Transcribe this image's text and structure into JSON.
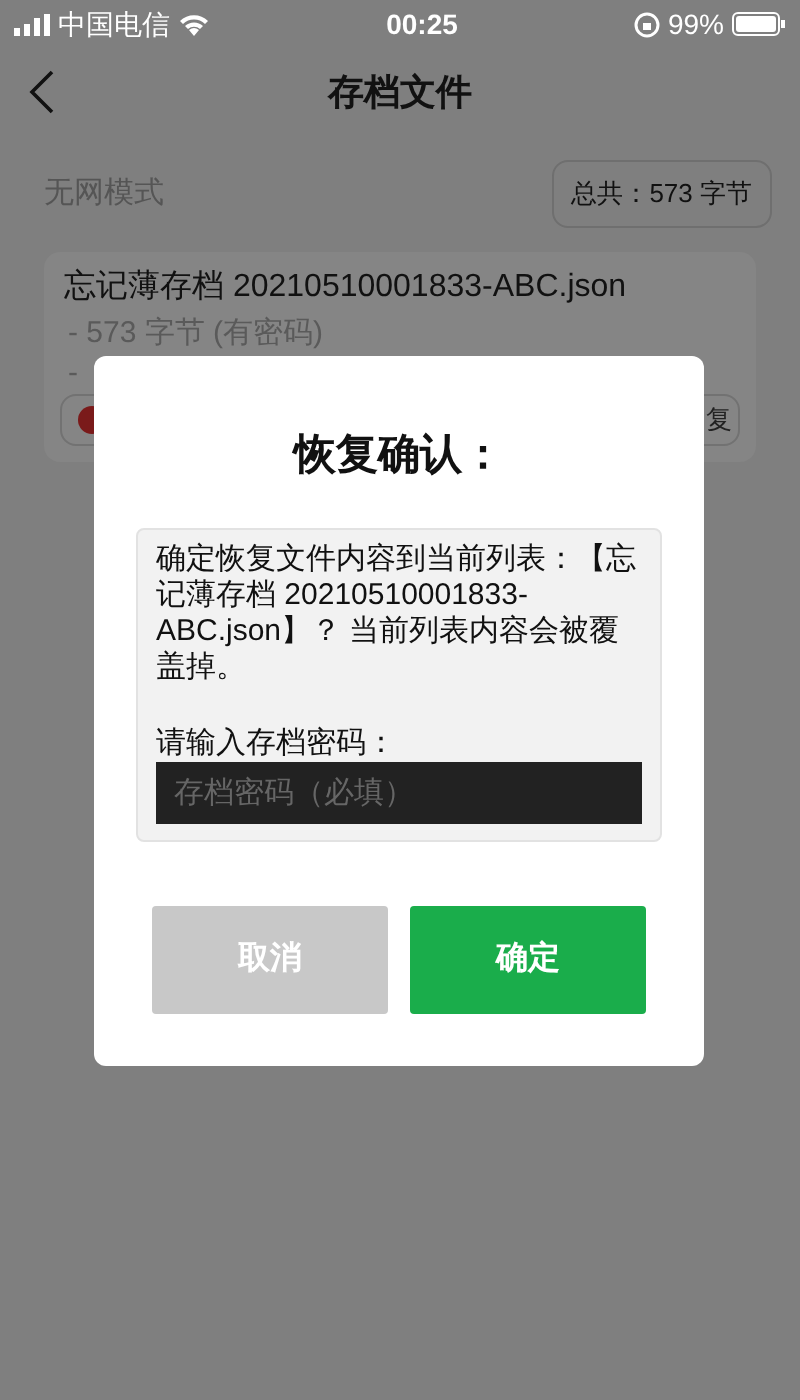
{
  "status_bar": {
    "carrier": "中国电信",
    "time": "00:25",
    "battery": "99%"
  },
  "nav": {
    "title": "存档文件"
  },
  "mode_label": "无网模式",
  "total_badge": "总共：573 字节",
  "files": [
    {
      "name": "忘记薄存档 20210510001833-ABC.json",
      "detail": "- 573 字节 (有密码)",
      "detail_2": "-",
      "restore_button": "复"
    }
  ],
  "dialog": {
    "title": "恢复确认：",
    "message": "确定恢复文件内容到当前列表：【忘记薄存档 20210510001833-ABC.json】？ 当前列表内容会被覆盖掉。",
    "password_label": "请输入存档密码：",
    "password": {
      "placeholder": "存档密码（必填）"
    },
    "buttons": [
      {
        "label": "取消",
        "kind": "cancel"
      },
      {
        "label": "确定",
        "kind": "confirm"
      }
    ]
  }
}
